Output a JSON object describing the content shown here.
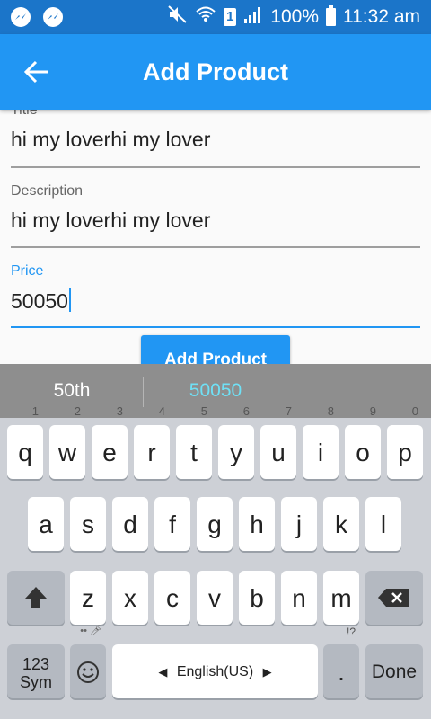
{
  "status_bar": {
    "battery": "100%",
    "time": "11:32 am",
    "sim": "1",
    "icons": [
      "messenger-icon",
      "messenger-icon",
      "mute-icon",
      "wifi-icon",
      "sim-icon",
      "signal-icon",
      "battery-icon"
    ]
  },
  "app_bar": {
    "title": "Add Product",
    "back_icon": "back-arrow-icon"
  },
  "form": {
    "title_label": "Title",
    "title_value": "hi my loverhi my lover",
    "description_label": "Description",
    "description_value": "hi my loverhi my lover",
    "price_label": "Price",
    "price_value": "50050",
    "submit_label": "Add Product"
  },
  "keyboard": {
    "suggestions": [
      "50th",
      "50050"
    ],
    "row1": [
      "q",
      "w",
      "e",
      "r",
      "t",
      "y",
      "u",
      "i",
      "o",
      "p"
    ],
    "row1_nums": [
      "1",
      "2",
      "3",
      "4",
      "5",
      "6",
      "7",
      "8",
      "9",
      "0"
    ],
    "row2": [
      "a",
      "s",
      "d",
      "f",
      "g",
      "h",
      "j",
      "k",
      "l"
    ],
    "row3": [
      "z",
      "x",
      "c",
      "v",
      "b",
      "n",
      "m"
    ],
    "sym_label_top": "123",
    "sym_label_bottom": "Sym",
    "language_label": "English(US)",
    "period_label": ".",
    "period_hint": "!?",
    "done_label": "Done"
  },
  "colors": {
    "accent": "#2196f3",
    "status_bar": "#1b75c9",
    "suggestion_highlight": "#6fe0f5"
  }
}
